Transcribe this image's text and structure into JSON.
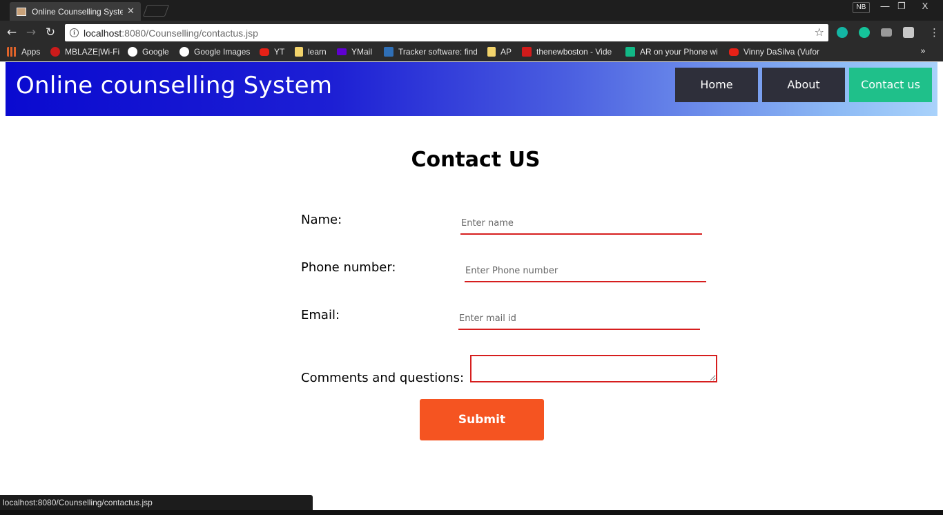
{
  "browser": {
    "tab_title": "Online Counselling Syste",
    "tab_close": "✕",
    "profile_badge": "NB",
    "window_controls": {
      "minimize": "—",
      "restore": "❐",
      "close": "X"
    },
    "url_host": "localhost",
    "url_rest": ":8080/Counselling/contactus.jsp",
    "bookmarks": [
      {
        "label": "Apps",
        "icon": "apps-grid-icon",
        "color": "#e0632a"
      },
      {
        "label": "MBLAZE|Wi-Fi",
        "icon": "opera-icon",
        "color": "#cc1b1b"
      },
      {
        "label": "Google",
        "icon": "google-icon",
        "color": "#ffffff"
      },
      {
        "label": "Google Images",
        "icon": "google-icon",
        "color": "#ffffff"
      },
      {
        "label": "YT",
        "icon": "youtube-icon",
        "color": "#e62117"
      },
      {
        "label": "learn",
        "icon": "folder-icon",
        "color": "#f2d36b"
      },
      {
        "label": "YMail",
        "icon": "ymail-icon",
        "color": "#5f01d1"
      },
      {
        "label": "Tracker software: find",
        "icon": "tracker-icon",
        "color": "#2f6fb6"
      },
      {
        "label": "AP",
        "icon": "folder-icon",
        "color": "#f2d36b"
      },
      {
        "label": "thenewboston - Vide",
        "icon": "thenewboston-icon",
        "color": "#d11b1b"
      },
      {
        "label": "AR on your Phone wi",
        "icon": "medium-icon",
        "color": "#12b886"
      },
      {
        "label": "Vinny DaSilva (Vufor",
        "icon": "youtube-icon",
        "color": "#e62117"
      }
    ],
    "bookmarks_more": "»",
    "status_url": "localhost:8080/Counselling/contactus.jsp"
  },
  "site": {
    "title": "Online counselling System",
    "nav": {
      "home": "Home",
      "about": "About",
      "contact": "Contact us"
    }
  },
  "form": {
    "heading": "Contact US",
    "name_label": "Name:",
    "name_placeholder": "Enter name",
    "phone_label": "Phone number:",
    "phone_placeholder": "Enter Phone number",
    "email_label": "Email:",
    "email_placeholder": "Enter mail id",
    "comments_label": "Comments and questions:",
    "submit_label": "Submit"
  },
  "colors": {
    "header_start": "#0a0ad0",
    "header_end": "#a9d2fb",
    "nav_dark": "#2e2f3a",
    "nav_active": "#1fc08a",
    "field_border": "#d61e1e",
    "submit_bg": "#f55421"
  }
}
